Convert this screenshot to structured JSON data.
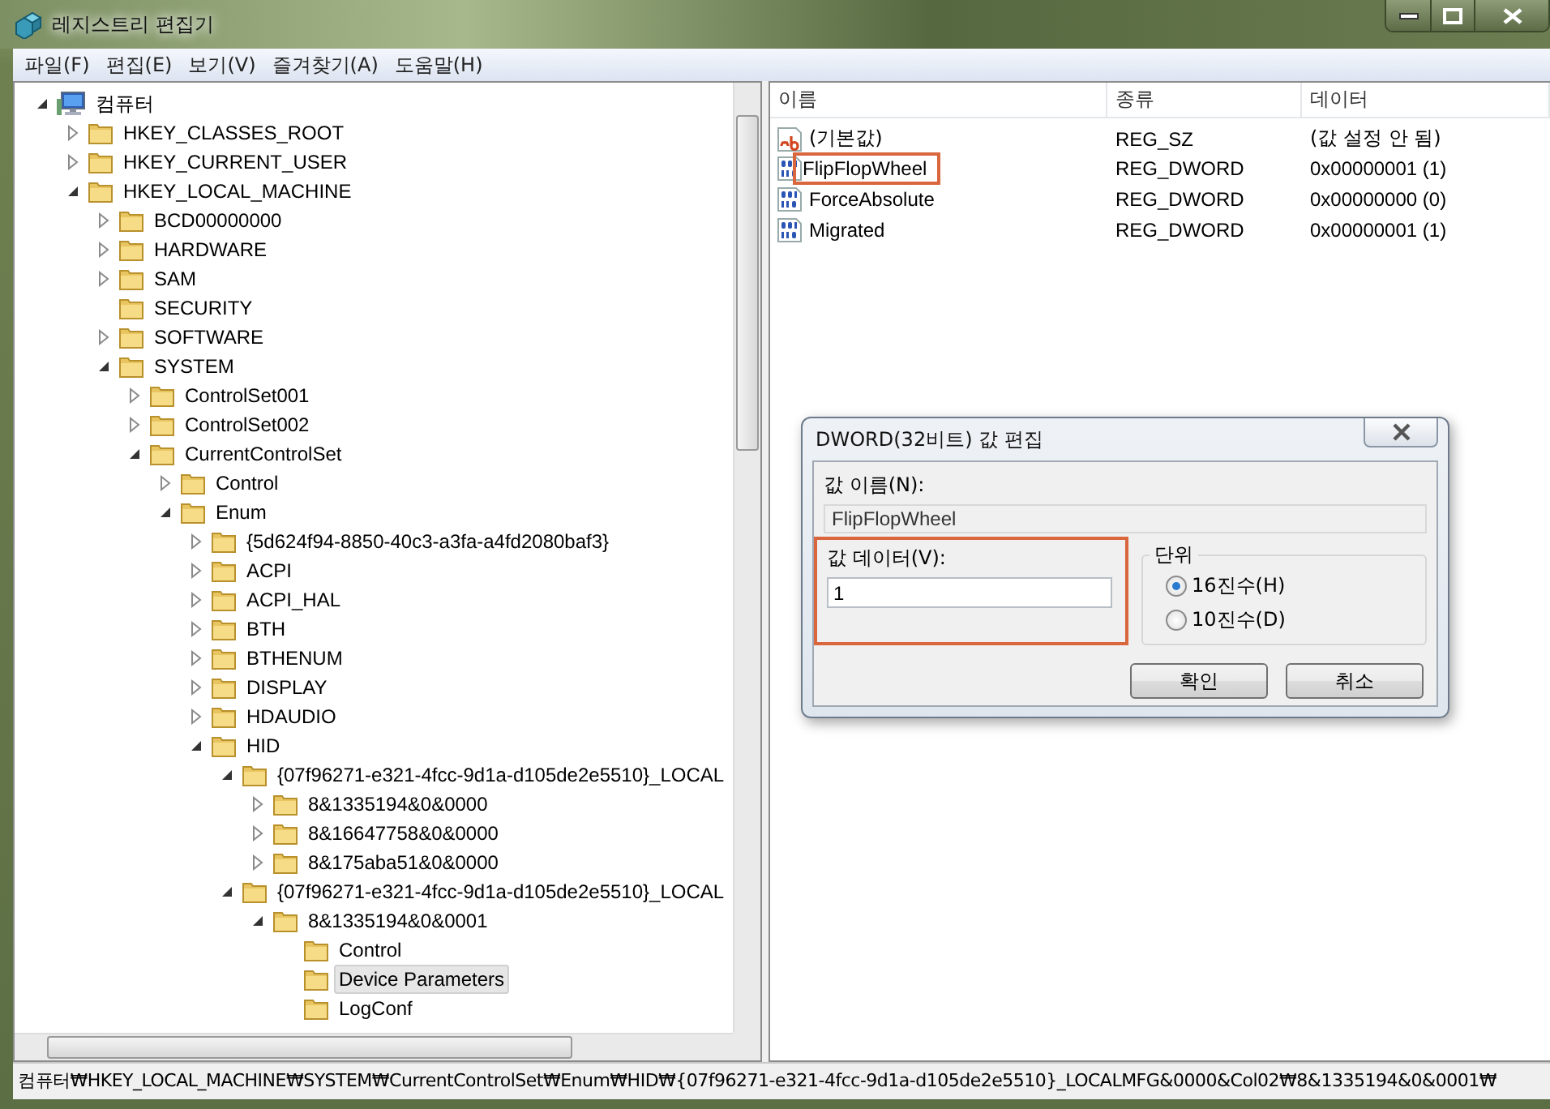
{
  "window": {
    "title": "레지스트리 편집기"
  },
  "menu": [
    "파일(F)",
    "편집(E)",
    "보기(V)",
    "즐겨찾기(A)",
    "도움말(H)"
  ],
  "tree": [
    {
      "label": "컴퓨터",
      "kind": "computer",
      "expandable": true,
      "expanded": true,
      "selected": false,
      "children": [
        {
          "label": "HKEY_CLASSES_ROOT",
          "kind": "folder",
          "expandable": true,
          "expanded": false,
          "selected": false
        },
        {
          "label": "HKEY_CURRENT_USER",
          "kind": "folder",
          "expandable": true,
          "expanded": false,
          "selected": false
        },
        {
          "label": "HKEY_LOCAL_MACHINE",
          "kind": "folder",
          "expandable": true,
          "expanded": true,
          "selected": false,
          "children": [
            {
              "label": "BCD00000000",
              "kind": "folder",
              "expandable": true,
              "expanded": false,
              "selected": false
            },
            {
              "label": "HARDWARE",
              "kind": "folder",
              "expandable": true,
              "expanded": false,
              "selected": false
            },
            {
              "label": "SAM",
              "kind": "folder",
              "expandable": true,
              "expanded": false,
              "selected": false
            },
            {
              "label": "SECURITY",
              "kind": "folder",
              "expandable": false,
              "selected": false
            },
            {
              "label": "SOFTWARE",
              "kind": "folder",
              "expandable": true,
              "expanded": false,
              "selected": false
            },
            {
              "label": "SYSTEM",
              "kind": "folder",
              "expandable": true,
              "expanded": true,
              "selected": false,
              "children": [
                {
                  "label": "ControlSet001",
                  "kind": "folder",
                  "expandable": true,
                  "expanded": false,
                  "selected": false
                },
                {
                  "label": "ControlSet002",
                  "kind": "folder",
                  "expandable": true,
                  "expanded": false,
                  "selected": false
                },
                {
                  "label": "CurrentControlSet",
                  "kind": "folder",
                  "expandable": true,
                  "expanded": true,
                  "selected": false,
                  "children": [
                    {
                      "label": "Control",
                      "kind": "folder",
                      "expandable": true,
                      "expanded": false,
                      "selected": false
                    },
                    {
                      "label": "Enum",
                      "kind": "folder",
                      "expandable": true,
                      "expanded": true,
                      "selected": false,
                      "children": [
                        {
                          "label": "{5d624f94-8850-40c3-a3fa-a4fd2080baf3}",
                          "kind": "folder",
                          "expandable": true,
                          "expanded": false,
                          "selected": false
                        },
                        {
                          "label": "ACPI",
                          "kind": "folder",
                          "expandable": true,
                          "expanded": false,
                          "selected": false
                        },
                        {
                          "label": "ACPI_HAL",
                          "kind": "folder",
                          "expandable": true,
                          "expanded": false,
                          "selected": false
                        },
                        {
                          "label": "BTH",
                          "kind": "folder",
                          "expandable": true,
                          "expanded": false,
                          "selected": false
                        },
                        {
                          "label": "BTHENUM",
                          "kind": "folder",
                          "expandable": true,
                          "expanded": false,
                          "selected": false
                        },
                        {
                          "label": "DISPLAY",
                          "kind": "folder",
                          "expandable": true,
                          "expanded": false,
                          "selected": false
                        },
                        {
                          "label": "HDAUDIO",
                          "kind": "folder",
                          "expandable": true,
                          "expanded": false,
                          "selected": false
                        },
                        {
                          "label": "HID",
                          "kind": "folder",
                          "expandable": true,
                          "expanded": true,
                          "selected": false,
                          "children": [
                            {
                              "label": "{07f96271-e321-4fcc-9d1a-d105de2e5510}_LOCAL",
                              "kind": "folder",
                              "expandable": true,
                              "expanded": true,
                              "selected": false,
                              "children": [
                                {
                                  "label": "8&1335194&0&0000",
                                  "kind": "folder",
                                  "expandable": true,
                                  "expanded": false,
                                  "selected": false
                                },
                                {
                                  "label": "8&16647758&0&0000",
                                  "kind": "folder",
                                  "expandable": true,
                                  "expanded": false,
                                  "selected": false
                                },
                                {
                                  "label": "8&175aba51&0&0000",
                                  "kind": "folder",
                                  "expandable": true,
                                  "expanded": false,
                                  "selected": false
                                }
                              ]
                            },
                            {
                              "label": "{07f96271-e321-4fcc-9d1a-d105de2e5510}_LOCAL",
                              "kind": "folder",
                              "expandable": true,
                              "expanded": true,
                              "selected": false,
                              "children": [
                                {
                                  "label": "8&1335194&0&0001",
                                  "kind": "folder",
                                  "expandable": true,
                                  "expanded": true,
                                  "selected": false,
                                  "children": [
                                    {
                                      "label": "Control",
                                      "kind": "folder",
                                      "expandable": false,
                                      "selected": false
                                    },
                                    {
                                      "label": "Device Parameters",
                                      "kind": "folder",
                                      "expandable": false,
                                      "selected": true
                                    },
                                    {
                                      "label": "LogConf",
                                      "kind": "folder",
                                      "expandable": false,
                                      "selected": false
                                    }
                                  ]
                                }
                              ]
                            }
                          ]
                        }
                      ]
                    }
                  ]
                }
              ]
            }
          ]
        }
      ]
    }
  ],
  "values": {
    "columns": [
      "이름",
      "종류",
      "데이터"
    ],
    "rows": [
      {
        "name": "(기본값)",
        "kind": "string",
        "type": "REG_SZ",
        "data": "(값 설정 안 됨)",
        "outlined": false
      },
      {
        "name": "FlipFlopWheel",
        "kind": "dword",
        "type": "REG_DWORD",
        "data": "0x00000001 (1)",
        "outlined": true
      },
      {
        "name": "ForceAbsolute",
        "kind": "dword",
        "type": "REG_DWORD",
        "data": "0x00000000 (0)",
        "outlined": false
      },
      {
        "name": "Migrated",
        "kind": "dword",
        "type": "REG_DWORD",
        "data": "0x00000001 (1)",
        "outlined": false
      }
    ]
  },
  "dialog": {
    "title": "DWORD(32비트) 값 편집",
    "name_label": "값 이름(N):",
    "name_value": "FlipFlopWheel",
    "data_label": "값 데이터(V):",
    "data_value": "1",
    "data_outlined": true,
    "units_label": "단위",
    "units": [
      {
        "label": "16진수(H)",
        "selected": true
      },
      {
        "label": "10진수(D)",
        "selected": false
      }
    ],
    "buttons": [
      "확인",
      "취소"
    ]
  },
  "status_bar": "컴퓨터₩HKEY_LOCAL_MACHINE₩SYSTEM₩CurrentControlSet₩Enum₩HID₩{07f96271-e321-4fcc-9d1a-d105de2e5510}_LOCALMFG&0000&Col02₩8&1335194&0&0001₩"
}
